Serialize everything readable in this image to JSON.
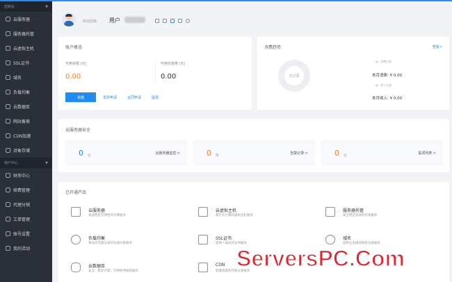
{
  "sidebar": {
    "header1": "控制台",
    "items1": [
      {
        "label": "云服务器",
        "icon": "server-icon"
      },
      {
        "label": "服务器托管",
        "icon": "rack-icon"
      },
      {
        "label": "云虚拟主机",
        "icon": "host-icon"
      },
      {
        "label": "SSL证书",
        "icon": "certificate-icon"
      },
      {
        "label": "域名",
        "icon": "globe-icon"
      },
      {
        "label": "负载均衡",
        "icon": "balance-icon"
      },
      {
        "label": "云数据库",
        "icon": "database-icon"
      },
      {
        "label": "网站备案",
        "icon": "record-icon"
      },
      {
        "label": "CDN加速",
        "icon": "cdn-icon"
      },
      {
        "label": "对象存储",
        "icon": "storage-icon"
      }
    ],
    "header2": "用户中心",
    "items2": [
      {
        "label": "财务中心",
        "icon": "finance-icon"
      },
      {
        "label": "续费管理",
        "icon": "renew-icon"
      },
      {
        "label": "代理分销",
        "icon": "agent-icon"
      },
      {
        "label": "工单管理",
        "icon": "ticket-icon"
      },
      {
        "label": "账号设置",
        "icon": "account-icon"
      },
      {
        "label": "我的活动",
        "icon": "activity-icon"
      }
    ]
  },
  "user": {
    "welcome": "欢迎回来,",
    "name": "用户"
  },
  "account": {
    "title": "账户概览",
    "balance_label": "可用余额 (元)",
    "balance_value": "0.00",
    "voucher_label": "可用代金券 (元)",
    "voucher_value": "0.00",
    "charge_button": "充值",
    "links": [
      "发票申请",
      "合同申请",
      "提现"
    ]
  },
  "consumption": {
    "title": "消费趋势",
    "more": "查看>",
    "empty": "无记录",
    "legend1": "消费记录",
    "month_spend": "本月消费: ¥ 0.00",
    "legend2": "收入记录",
    "month_income": "本月收入: ¥ 0.00"
  },
  "security": {
    "title": "云服务器安全",
    "stats": [
      {
        "value": "0",
        "unit": "台",
        "link": "云服务器监控 >",
        "color": "#2e8ae6"
      },
      {
        "value": "0",
        "unit": "条",
        "link": "告警记录 >",
        "color": "#f5822a"
      },
      {
        "value": "0",
        "unit": "台",
        "link": "黑洞列表 >",
        "color": "#f5822a"
      }
    ]
  },
  "products": {
    "title": "已开通产品",
    "items": [
      {
        "name": "云服务器",
        "desc": "高速稳定可弹性的计算服务",
        "icon": "server-icon"
      },
      {
        "name": "云虚拟主机",
        "desc": "基于云计算的虚拟主机服务",
        "icon": "cube-icon"
      },
      {
        "name": "服务器托管",
        "desc": "安全稳定高效的托管服务",
        "icon": "rack-icon"
      },
      {
        "name": "负载均衡",
        "desc": "将访问流量分发的负载均衡服务",
        "icon": "balance-icon"
      },
      {
        "name": "SSL证书",
        "desc": "提供一站式的证书服务",
        "icon": "certificate-icon"
      },
      {
        "name": "域名",
        "desc": "提供五星级的域名注册服务",
        "icon": "globe-icon"
      },
      {
        "name": "云数据库",
        "desc": "安全、稳定可靠、可弹性伸缩的服务",
        "icon": "database-icon"
      },
      {
        "name": "CDN",
        "desc": "智能调度的内容分发服务",
        "icon": "cdn-icon"
      }
    ]
  },
  "watermark": "ServersPC.Com"
}
